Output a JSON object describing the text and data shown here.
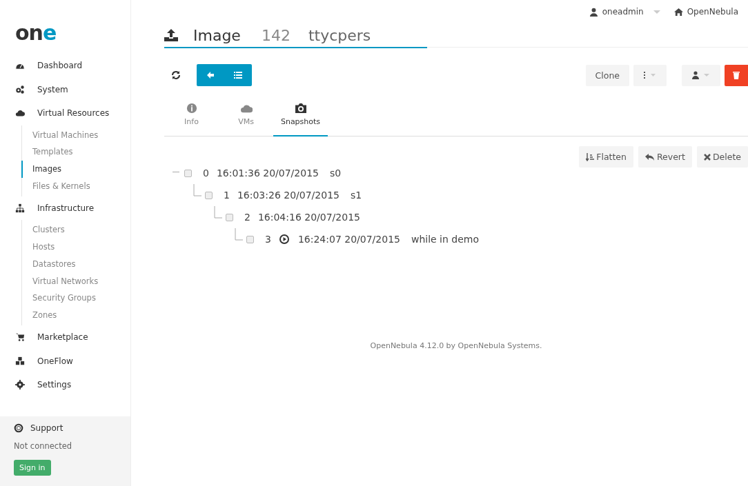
{
  "logo": [
    {
      "text": "on"
    },
    {
      "text": "e"
    }
  ],
  "sidebar": {
    "items": [
      {
        "label": "Dashboard"
      },
      {
        "label": "System"
      },
      {
        "label": "Virtual Resources",
        "children": [
          {
            "label": "Virtual Machines",
            "selected": false
          },
          {
            "label": "Templates",
            "selected": false
          },
          {
            "label": "Images",
            "selected": true
          },
          {
            "label": "Files & Kernels",
            "selected": false
          }
        ]
      },
      {
        "label": "Infrastructure",
        "children": [
          {
            "label": "Clusters",
            "selected": false
          },
          {
            "label": "Hosts",
            "selected": false
          },
          {
            "label": "Datastores",
            "selected": false
          },
          {
            "label": "Virtual Networks",
            "selected": false
          },
          {
            "label": "Security Groups",
            "selected": false
          },
          {
            "label": "Zones",
            "selected": false
          }
        ]
      },
      {
        "label": "Marketplace"
      },
      {
        "label": "OneFlow"
      },
      {
        "label": "Settings"
      }
    ],
    "support": {
      "title": "Support",
      "status": "Not connected",
      "button": "Sign in"
    }
  },
  "topbar": {
    "user": "oneadmin",
    "zone": "OpenNebula"
  },
  "header": {
    "resource": "Image",
    "id": "142",
    "name": "ttycpers"
  },
  "toolbar": {
    "clone": "Clone"
  },
  "tabs": [
    {
      "label": "Info",
      "selected": false
    },
    {
      "label": "VMs",
      "selected": false
    },
    {
      "label": "Snapshots",
      "selected": true
    }
  ],
  "actions": [
    "Flatten",
    "Revert",
    "Delete"
  ],
  "snapshots": [
    {
      "id": "0",
      "time": "16:01:36 20/07/2015",
      "name": "s0",
      "checked": false,
      "active": false,
      "children": [
        {
          "id": "1",
          "time": "16:03:26 20/07/2015",
          "name": "s1",
          "checked": false,
          "active": false,
          "children": [
            {
              "id": "2",
              "time": "16:04:16 20/07/2015",
              "checked": false,
              "active": false,
              "children": [
                {
                  "id": "3",
                  "time": "16:24:07 20/07/2015",
                  "name": "while in demo",
                  "checked": false,
                  "active": true
                }
              ]
            }
          ]
        }
      ]
    }
  ],
  "footer": "OpenNebula 4.12.0 by OpenNebula Systems."
}
